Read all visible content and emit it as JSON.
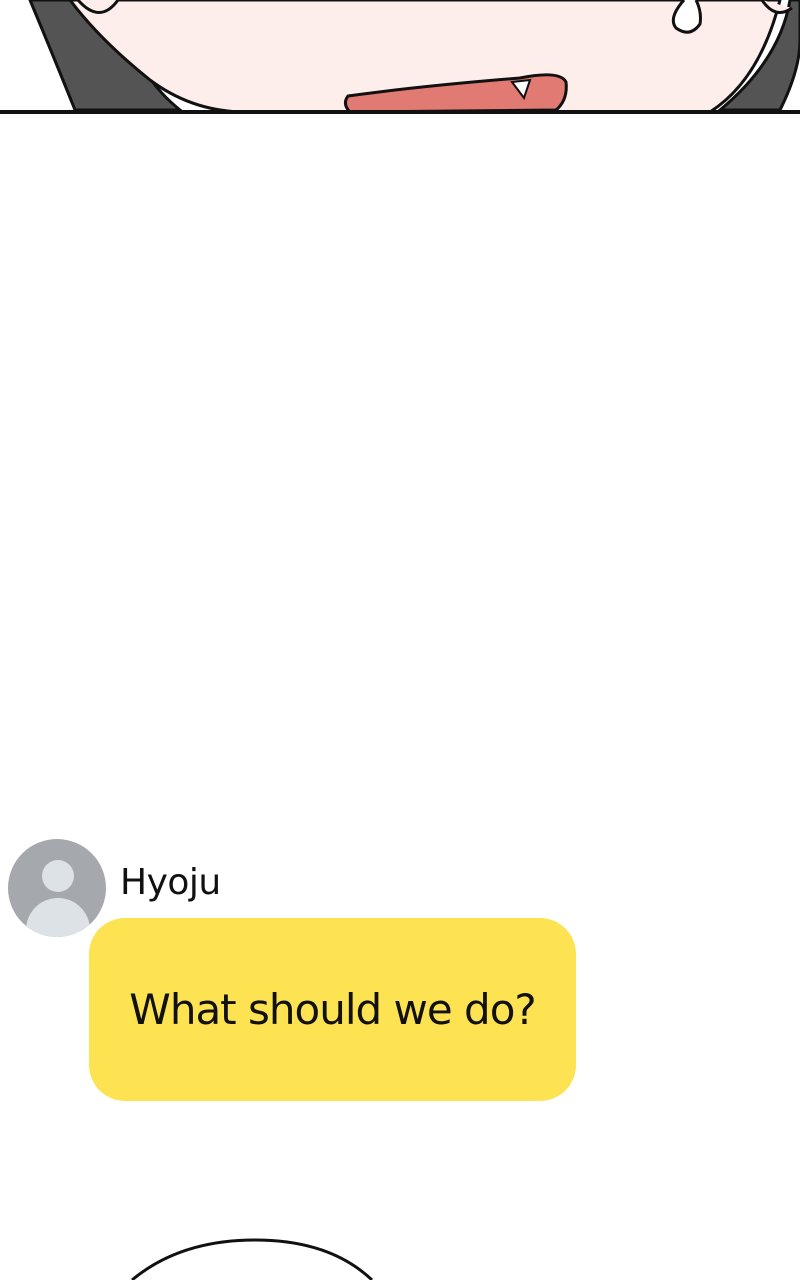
{
  "chat": {
    "sender_name": "Hyoju",
    "message": "What should we do?"
  },
  "colors": {
    "bubble": "#fde352",
    "avatar_bg": "#a5a9ad",
    "avatar_fg": "#dde2e6",
    "skin": "#fdeeec",
    "hair": "#545454",
    "tongue": "#e07a72"
  },
  "icons": [
    "avatar-silhouette-icon"
  ]
}
